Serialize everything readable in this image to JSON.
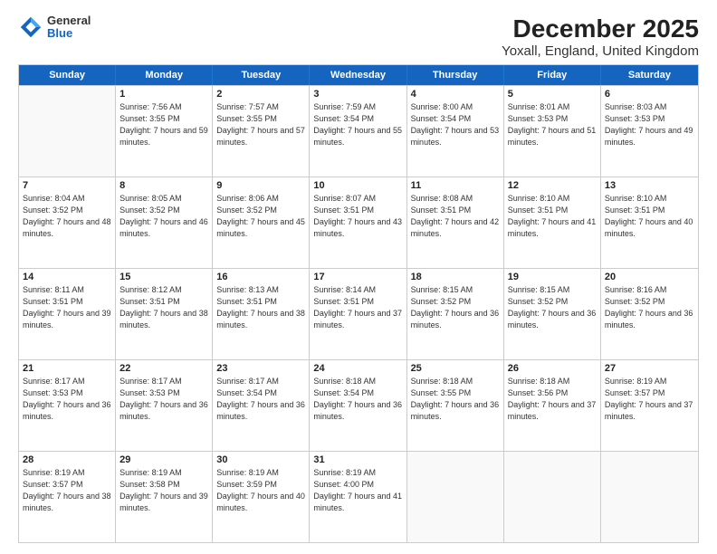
{
  "header": {
    "logo_general": "General",
    "logo_blue": "Blue",
    "title": "December 2025",
    "subtitle": "Yoxall, England, United Kingdom"
  },
  "weekdays": [
    "Sunday",
    "Monday",
    "Tuesday",
    "Wednesday",
    "Thursday",
    "Friday",
    "Saturday"
  ],
  "weeks": [
    [
      {
        "day": "",
        "sunrise": "",
        "sunset": "",
        "daylight": ""
      },
      {
        "day": "1",
        "sunrise": "Sunrise: 7:56 AM",
        "sunset": "Sunset: 3:55 PM",
        "daylight": "Daylight: 7 hours and 59 minutes."
      },
      {
        "day": "2",
        "sunrise": "Sunrise: 7:57 AM",
        "sunset": "Sunset: 3:55 PM",
        "daylight": "Daylight: 7 hours and 57 minutes."
      },
      {
        "day": "3",
        "sunrise": "Sunrise: 7:59 AM",
        "sunset": "Sunset: 3:54 PM",
        "daylight": "Daylight: 7 hours and 55 minutes."
      },
      {
        "day": "4",
        "sunrise": "Sunrise: 8:00 AM",
        "sunset": "Sunset: 3:54 PM",
        "daylight": "Daylight: 7 hours and 53 minutes."
      },
      {
        "day": "5",
        "sunrise": "Sunrise: 8:01 AM",
        "sunset": "Sunset: 3:53 PM",
        "daylight": "Daylight: 7 hours and 51 minutes."
      },
      {
        "day": "6",
        "sunrise": "Sunrise: 8:03 AM",
        "sunset": "Sunset: 3:53 PM",
        "daylight": "Daylight: 7 hours and 49 minutes."
      }
    ],
    [
      {
        "day": "7",
        "sunrise": "Sunrise: 8:04 AM",
        "sunset": "Sunset: 3:52 PM",
        "daylight": "Daylight: 7 hours and 48 minutes."
      },
      {
        "day": "8",
        "sunrise": "Sunrise: 8:05 AM",
        "sunset": "Sunset: 3:52 PM",
        "daylight": "Daylight: 7 hours and 46 minutes."
      },
      {
        "day": "9",
        "sunrise": "Sunrise: 8:06 AM",
        "sunset": "Sunset: 3:52 PM",
        "daylight": "Daylight: 7 hours and 45 minutes."
      },
      {
        "day": "10",
        "sunrise": "Sunrise: 8:07 AM",
        "sunset": "Sunset: 3:51 PM",
        "daylight": "Daylight: 7 hours and 43 minutes."
      },
      {
        "day": "11",
        "sunrise": "Sunrise: 8:08 AM",
        "sunset": "Sunset: 3:51 PM",
        "daylight": "Daylight: 7 hours and 42 minutes."
      },
      {
        "day": "12",
        "sunrise": "Sunrise: 8:10 AM",
        "sunset": "Sunset: 3:51 PM",
        "daylight": "Daylight: 7 hours and 41 minutes."
      },
      {
        "day": "13",
        "sunrise": "Sunrise: 8:10 AM",
        "sunset": "Sunset: 3:51 PM",
        "daylight": "Daylight: 7 hours and 40 minutes."
      }
    ],
    [
      {
        "day": "14",
        "sunrise": "Sunrise: 8:11 AM",
        "sunset": "Sunset: 3:51 PM",
        "daylight": "Daylight: 7 hours and 39 minutes."
      },
      {
        "day": "15",
        "sunrise": "Sunrise: 8:12 AM",
        "sunset": "Sunset: 3:51 PM",
        "daylight": "Daylight: 7 hours and 38 minutes."
      },
      {
        "day": "16",
        "sunrise": "Sunrise: 8:13 AM",
        "sunset": "Sunset: 3:51 PM",
        "daylight": "Daylight: 7 hours and 38 minutes."
      },
      {
        "day": "17",
        "sunrise": "Sunrise: 8:14 AM",
        "sunset": "Sunset: 3:51 PM",
        "daylight": "Daylight: 7 hours and 37 minutes."
      },
      {
        "day": "18",
        "sunrise": "Sunrise: 8:15 AM",
        "sunset": "Sunset: 3:52 PM",
        "daylight": "Daylight: 7 hours and 36 minutes."
      },
      {
        "day": "19",
        "sunrise": "Sunrise: 8:15 AM",
        "sunset": "Sunset: 3:52 PM",
        "daylight": "Daylight: 7 hours and 36 minutes."
      },
      {
        "day": "20",
        "sunrise": "Sunrise: 8:16 AM",
        "sunset": "Sunset: 3:52 PM",
        "daylight": "Daylight: 7 hours and 36 minutes."
      }
    ],
    [
      {
        "day": "21",
        "sunrise": "Sunrise: 8:17 AM",
        "sunset": "Sunset: 3:53 PM",
        "daylight": "Daylight: 7 hours and 36 minutes."
      },
      {
        "day": "22",
        "sunrise": "Sunrise: 8:17 AM",
        "sunset": "Sunset: 3:53 PM",
        "daylight": "Daylight: 7 hours and 36 minutes."
      },
      {
        "day": "23",
        "sunrise": "Sunrise: 8:17 AM",
        "sunset": "Sunset: 3:54 PM",
        "daylight": "Daylight: 7 hours and 36 minutes."
      },
      {
        "day": "24",
        "sunrise": "Sunrise: 8:18 AM",
        "sunset": "Sunset: 3:54 PM",
        "daylight": "Daylight: 7 hours and 36 minutes."
      },
      {
        "day": "25",
        "sunrise": "Sunrise: 8:18 AM",
        "sunset": "Sunset: 3:55 PM",
        "daylight": "Daylight: 7 hours and 36 minutes."
      },
      {
        "day": "26",
        "sunrise": "Sunrise: 8:18 AM",
        "sunset": "Sunset: 3:56 PM",
        "daylight": "Daylight: 7 hours and 37 minutes."
      },
      {
        "day": "27",
        "sunrise": "Sunrise: 8:19 AM",
        "sunset": "Sunset: 3:57 PM",
        "daylight": "Daylight: 7 hours and 37 minutes."
      }
    ],
    [
      {
        "day": "28",
        "sunrise": "Sunrise: 8:19 AM",
        "sunset": "Sunset: 3:57 PM",
        "daylight": "Daylight: 7 hours and 38 minutes."
      },
      {
        "day": "29",
        "sunrise": "Sunrise: 8:19 AM",
        "sunset": "Sunset: 3:58 PM",
        "daylight": "Daylight: 7 hours and 39 minutes."
      },
      {
        "day": "30",
        "sunrise": "Sunrise: 8:19 AM",
        "sunset": "Sunset: 3:59 PM",
        "daylight": "Daylight: 7 hours and 40 minutes."
      },
      {
        "day": "31",
        "sunrise": "Sunrise: 8:19 AM",
        "sunset": "Sunset: 4:00 PM",
        "daylight": "Daylight: 7 hours and 41 minutes."
      },
      {
        "day": "",
        "sunrise": "",
        "sunset": "",
        "daylight": ""
      },
      {
        "day": "",
        "sunrise": "",
        "sunset": "",
        "daylight": ""
      },
      {
        "day": "",
        "sunrise": "",
        "sunset": "",
        "daylight": ""
      }
    ]
  ]
}
